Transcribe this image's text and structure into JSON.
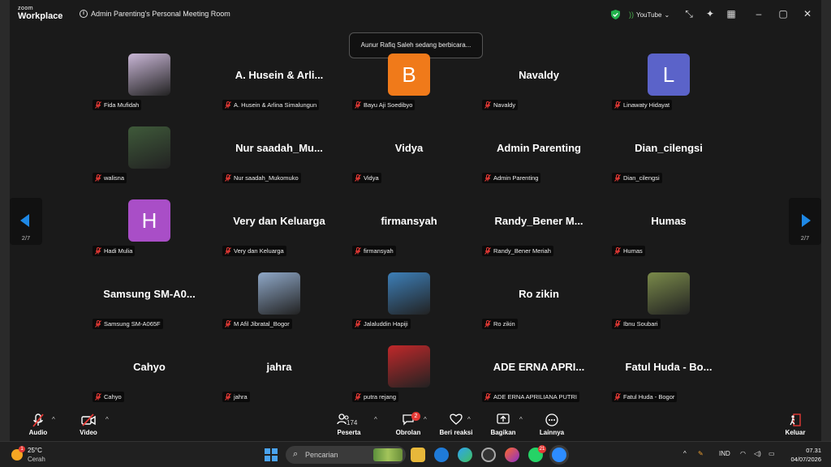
{
  "app": {
    "brand_top": "zoom",
    "brand_bottom": "Workplace",
    "meeting_title": "Admin Parenting's Personal Meeting Room"
  },
  "titlebar": {
    "stream_label": "YouTube"
  },
  "toast": "Aunur Rafiq Saleh sedang berbicara...",
  "pagination": {
    "left": "2/7",
    "right": "2/7"
  },
  "participants": [
    {
      "label": "Fida Mufidah",
      "big": "",
      "avatar": "photo",
      "color": "#c9b6d6"
    },
    {
      "label": "A. Husein & Arlina Simalungun",
      "big": "A. Husein & Arli...",
      "avatar": "none"
    },
    {
      "label": "Bayu Aji Soedibyo",
      "big": "",
      "avatar": "letter",
      "letter": "B",
      "color": "#f07a1a"
    },
    {
      "label": "Navaldy",
      "big": "Navaldy",
      "avatar": "none"
    },
    {
      "label": "Linawaty Hidayat",
      "big": "",
      "avatar": "letter",
      "letter": "L",
      "color": "#5b63c9"
    },
    {
      "label": "walisna",
      "big": "",
      "avatar": "photo",
      "color": "#3f5a3a"
    },
    {
      "label": "Nur saadah_Mukomuko",
      "big": "Nur saadah_Mu...",
      "avatar": "none"
    },
    {
      "label": "Vidya",
      "big": "Vidya",
      "avatar": "none"
    },
    {
      "label": "Admin Parenting",
      "big": "Admin Parenting",
      "avatar": "none"
    },
    {
      "label": "Dian_cilengsi",
      "big": "Dian_cilengsi",
      "avatar": "none"
    },
    {
      "label": "Hadi Mulia",
      "big": "",
      "avatar": "letter",
      "letter": "H",
      "color": "#a94ec7"
    },
    {
      "label": "Very dan Keluarga",
      "big": "Very dan Keluarga",
      "avatar": "none"
    },
    {
      "label": "firmansyah",
      "big": "firmansyah",
      "avatar": "none"
    },
    {
      "label": "Randy_Bener Meriah",
      "big": "Randy_Bener M...",
      "avatar": "none"
    },
    {
      "label": "Humas",
      "big": "Humas",
      "avatar": "none"
    },
    {
      "label": "Samsung SM-A065F",
      "big": "Samsung SM-A0...",
      "avatar": "none"
    },
    {
      "label": "M Afil Jibratal_Bogor",
      "big": "",
      "avatar": "photo",
      "color": "#8fa8c8"
    },
    {
      "label": "Jalaluddin Hapiji",
      "big": "",
      "avatar": "photo",
      "color": "#3d7fb8"
    },
    {
      "label": "Ro zikin",
      "big": "Ro zikin",
      "avatar": "none"
    },
    {
      "label": "Ibnu Soubari",
      "big": "",
      "avatar": "photo",
      "color": "#7a8a4a"
    },
    {
      "label": "Cahyo",
      "big": "Cahyo",
      "avatar": "none"
    },
    {
      "label": "jahra",
      "big": "jahra",
      "avatar": "none"
    },
    {
      "label": "putra rejang",
      "big": "",
      "avatar": "photo",
      "color": "#c0282a"
    },
    {
      "label": "ADE ERNA APRILIANA PUTRI",
      "big": "ADE ERNA APRI...",
      "avatar": "none"
    },
    {
      "label": "Fatul Huda - Bogor",
      "big": "Fatul Huda - Bo...",
      "avatar": "none"
    }
  ],
  "toolbar": {
    "audio": "Audio",
    "video": "Video",
    "participants": "Peserta",
    "participants_count": "174",
    "chat": "Obrolan",
    "chat_badge": "2",
    "reactions": "Beri reaksi",
    "share": "Bagikan",
    "more": "Lainnya",
    "leave": "Keluar"
  },
  "taskbar": {
    "weather_badge": "1",
    "temp": "25°C",
    "condition": "Cerah",
    "search_placeholder": "Pencarian",
    "app_badge": "21",
    "lang": "IND",
    "time": "07.31",
    "date": "04/07/2026"
  },
  "colors": {
    "accent": "#1e88e5",
    "danger": "#e53935"
  }
}
